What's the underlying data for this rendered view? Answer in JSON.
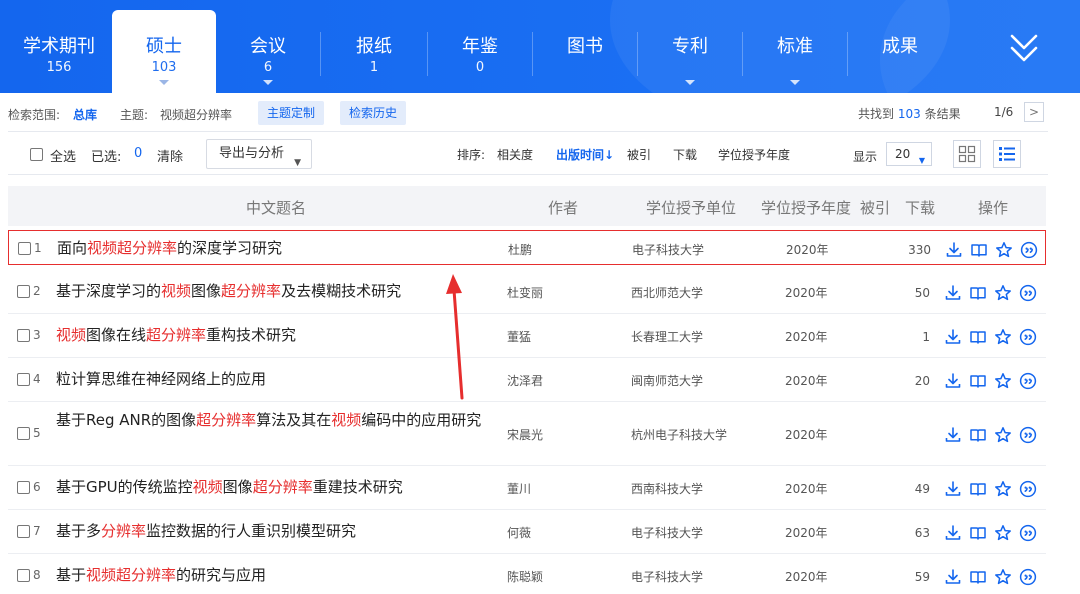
{
  "nav": {
    "tabs": [
      {
        "label": "学术期刊",
        "count": "156"
      },
      {
        "label": "硕士",
        "count": "103"
      },
      {
        "label": "会议",
        "count": "6"
      },
      {
        "label": "报纸",
        "count": "1"
      },
      {
        "label": "年鉴",
        "count": "0"
      },
      {
        "label": "图书",
        "count": ""
      },
      {
        "label": "专利",
        "count": ""
      },
      {
        "label": "标准",
        "count": ""
      },
      {
        "label": "成果",
        "count": ""
      }
    ],
    "active_tab": "硕士"
  },
  "search_info": {
    "scope_label": "检索范围:",
    "scope_value": "总库",
    "topic_label": "主题:",
    "topic_value": "视频超分辨率",
    "custom_button": "主题定制",
    "history_button": "检索历史",
    "found_prefix": "共找到",
    "found_count": "103",
    "found_suffix": "条结果",
    "page_indicator": "1/6",
    "next_page": ">"
  },
  "toolbar": {
    "select_all": "全选",
    "selected_label": "已选:",
    "selected_count": "0",
    "clear": "清除",
    "export": "导出与分析",
    "sort_label": "排序:",
    "sort_options": [
      "相关度",
      "出版时间",
      "被引",
      "下载",
      "学位授予年度"
    ],
    "sort_active": "出版时间",
    "display_label": "显示",
    "page_size": "20"
  },
  "table": {
    "headers": {
      "title": "中文题名",
      "author": "作者",
      "unit": "学位授予单位",
      "year": "学位授予年度",
      "cited": "被引",
      "downloads": "下载",
      "actions": "操作"
    },
    "rows": [
      {
        "index": "1",
        "title": "面向视频超分辨率的深度学习研究",
        "author": "杜鹏",
        "unit": "电子科技大学",
        "year": "2020年",
        "downloads": "330",
        "highlighted": true
      },
      {
        "index": "2",
        "title": "基于深度学习的视频图像超分辨率及去模糊技术研究",
        "author": "杜变丽",
        "unit": "西北师范大学",
        "year": "2020年",
        "downloads": "50",
        "highlighted": false
      },
      {
        "index": "3",
        "title": "视频图像在线超分辨率重构技术研究",
        "author": "董猛",
        "unit": "长春理工大学",
        "year": "2020年",
        "downloads": "1",
        "highlighted": false
      },
      {
        "index": "4",
        "title": "粒计算思维在神经网络上的应用",
        "author": "沈泽君",
        "unit": "闽南师范大学",
        "year": "2020年",
        "downloads": "20",
        "highlighted": false
      },
      {
        "index": "5",
        "title": "基于Reg ANR的图像超分辨率算法及其在视频编码中的应用研究",
        "author": "宋晨光",
        "unit": "杭州电子科技大学",
        "year": "2020年",
        "downloads": "",
        "highlighted": false
      },
      {
        "index": "6",
        "title": "基于GPU的传统监控视频图像超分辨率重建技术研究",
        "author": "董川",
        "unit": "西南科技大学",
        "year": "2020年",
        "downloads": "49",
        "highlighted": false
      },
      {
        "index": "7",
        "title": "基于多分辨率监控数据的行人重识别模型研究",
        "author": "何薇",
        "unit": "电子科技大学",
        "year": "2020年",
        "downloads": "63",
        "highlighted": false
      },
      {
        "index": "8",
        "title": "基于视频超分辨率的研究与应用",
        "author": "陈聪颖",
        "unit": "电子科技大学",
        "year": "2020年",
        "downloads": "59",
        "highlighted": false
      }
    ],
    "highlight_terms": [
      "视频",
      "超分辨率",
      "分辨率"
    ]
  },
  "icons": {
    "row_actions": [
      "download-icon",
      "read-online-icon",
      "favorite-star-icon",
      "quote-icon"
    ],
    "nav_more": "double-chevron-down-icon",
    "view_grid": "grid-view-icon",
    "view_list": "list-view-icon"
  },
  "colors": {
    "brand_blue": "#1466ee",
    "highlight_red": "#e62e2e",
    "annotation_red": "#e62e2e"
  }
}
